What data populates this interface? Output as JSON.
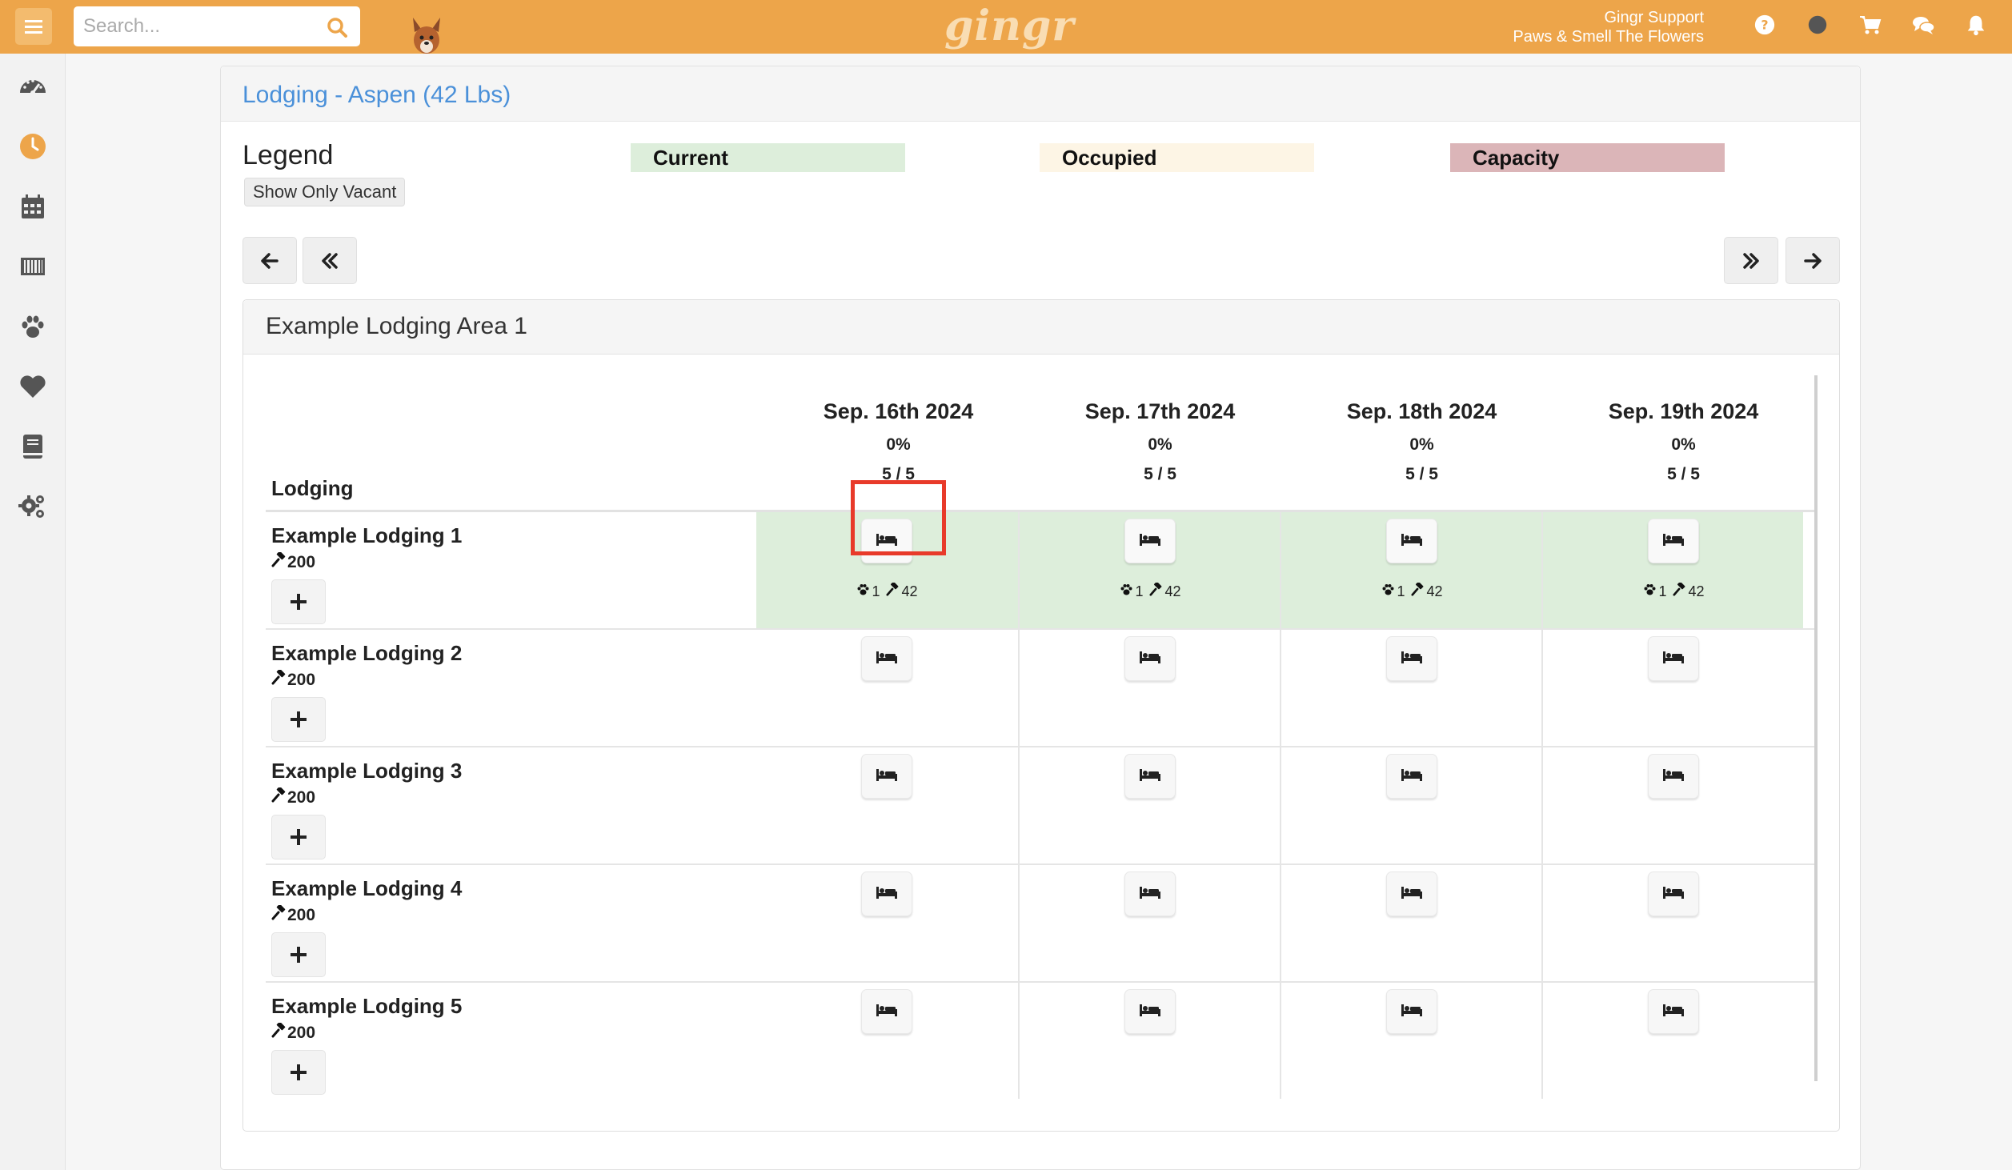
{
  "topbar": {
    "search_placeholder": "Search...",
    "logo": "gingr",
    "user_name": "Gingr Support",
    "business_name": "Paws & Smell The Flowers",
    "icons": [
      "help-icon",
      "status-dot-icon",
      "cart-icon",
      "chat-icon",
      "bell-icon"
    ]
  },
  "sidebar": {
    "items": [
      "dashboard-icon",
      "clock-icon",
      "calendar-icon",
      "barcode-icon",
      "paw-icon",
      "heart-icon",
      "book-icon",
      "settings-icon"
    ],
    "active_index": 1
  },
  "panel": {
    "title": "Lodging - Aspen (42 Lbs)"
  },
  "legend": {
    "label": "Legend",
    "show_vacant": "Show Only Vacant",
    "current": "Current",
    "occupied": "Occupied",
    "capacity": "Capacity",
    "colors": {
      "current": "#ddeedb",
      "occupied": "#fdf5e5",
      "capacity": "#dbb5b8"
    }
  },
  "area": {
    "title": "Example Lodging Area 1",
    "lodging_header": "Lodging",
    "dates": [
      {
        "date": "Sep. 16th 2024",
        "percent": "0%",
        "count": "5 / 5"
      },
      {
        "date": "Sep. 17th 2024",
        "percent": "0%",
        "count": "5 / 5"
      },
      {
        "date": "Sep. 18th 2024",
        "percent": "0%",
        "count": "5 / 5"
      },
      {
        "date": "Sep. 19th 2024",
        "percent": "0%",
        "count": "5 / 5"
      }
    ],
    "rows": [
      {
        "name": "Example Lodging 1",
        "capacity": "200",
        "current": true,
        "occupancy": {
          "pets": "1",
          "weight": "42"
        }
      },
      {
        "name": "Example Lodging 2",
        "capacity": "200",
        "current": false
      },
      {
        "name": "Example Lodging 3",
        "capacity": "200",
        "current": false
      },
      {
        "name": "Example Lodging 4",
        "capacity": "200",
        "current": false
      },
      {
        "name": "Example Lodging 5",
        "capacity": "200",
        "current": false
      }
    ]
  },
  "accent_color": "#eda54a",
  "link_color": "#4a90d9"
}
